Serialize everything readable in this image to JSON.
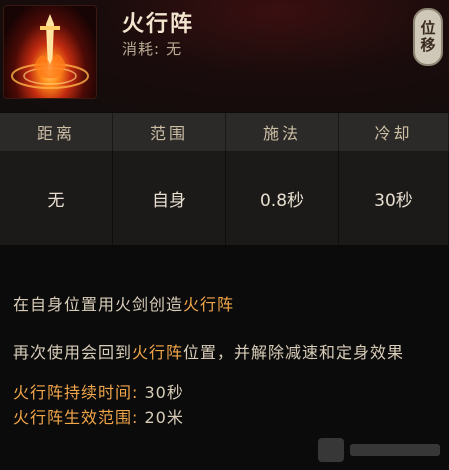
{
  "skill": {
    "icon": "fire-sword-icon",
    "name": "火行阵",
    "cost_label": "消耗:",
    "cost_value": "无",
    "badge_label": "位移"
  },
  "stats": [
    {
      "label": "距离",
      "value": "无"
    },
    {
      "label": "范围",
      "value": "自身"
    },
    {
      "label": "施法",
      "value": "0.8秒"
    },
    {
      "label": "冷却",
      "value": "30秒"
    }
  ],
  "description": {
    "line1_prefix": "在自身位置用火剑创造",
    "line1_highlight": "火行阵",
    "line2_prefix": "再次使用会回到",
    "line2_highlight": "火行阵",
    "line2_suffix": "位置，并解除减速和定身效果",
    "duration_label": "火行阵持续时间:",
    "duration_value": "30秒",
    "range_label": "火行阵生效范围:",
    "range_value": "20米"
  },
  "colors": {
    "highlight": "#f2a64a",
    "title": "#f3e6cf",
    "text": "#d8cdb9"
  }
}
